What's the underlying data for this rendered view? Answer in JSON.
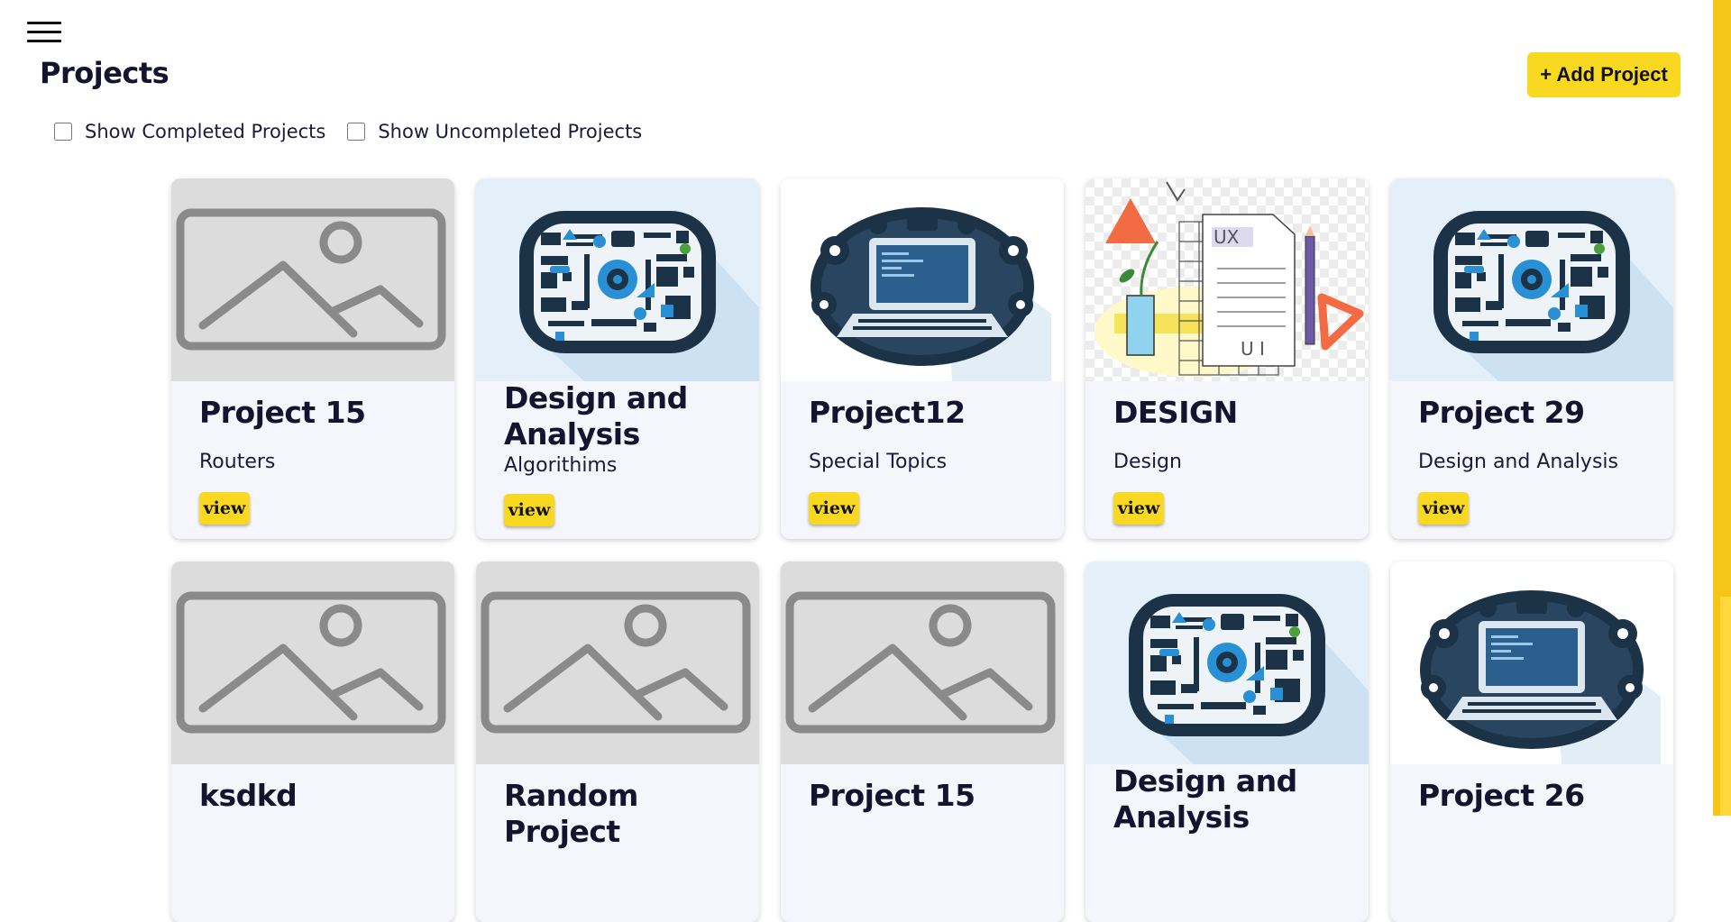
{
  "header": {
    "title": "Projects",
    "add_label": "+ Add Project"
  },
  "filters": {
    "completed_label": "Show Completed Projects",
    "uncompleted_label": "Show Uncompleted Projects"
  },
  "projects": [
    {
      "title": "Project 15",
      "subtitle": "Routers",
      "thumbnail": "placeholder-image",
      "view_label": "view"
    },
    {
      "title": "Design and Analysis",
      "subtitle": "Algorithims",
      "thumbnail": "circuit-illustration",
      "view_label": "view"
    },
    {
      "title": "Project12",
      "subtitle": "Special Topics",
      "thumbnail": "laptop-gears-illustration",
      "view_label": "view"
    },
    {
      "title": "DESIGN",
      "subtitle": "Design",
      "thumbnail": "ux-ui-illustration",
      "view_label": "view"
    },
    {
      "title": "Project 29",
      "subtitle": "Design and Analysis",
      "thumbnail": "circuit-illustration",
      "view_label": "view"
    },
    {
      "title": "ksdkd",
      "thumbnail": "placeholder-image"
    },
    {
      "title": "Random Project",
      "thumbnail": "placeholder-image"
    },
    {
      "title": "Project 15",
      "thumbnail": "placeholder-image"
    },
    {
      "title": "Design and Analysis",
      "thumbnail": "circuit-illustration"
    },
    {
      "title": "Project 26",
      "thumbnail": "laptop-gears-illustration"
    }
  ],
  "colors": {
    "accent": "#f9d821",
    "card_bg": "#f5f6fb",
    "title_text": "#14142e"
  }
}
